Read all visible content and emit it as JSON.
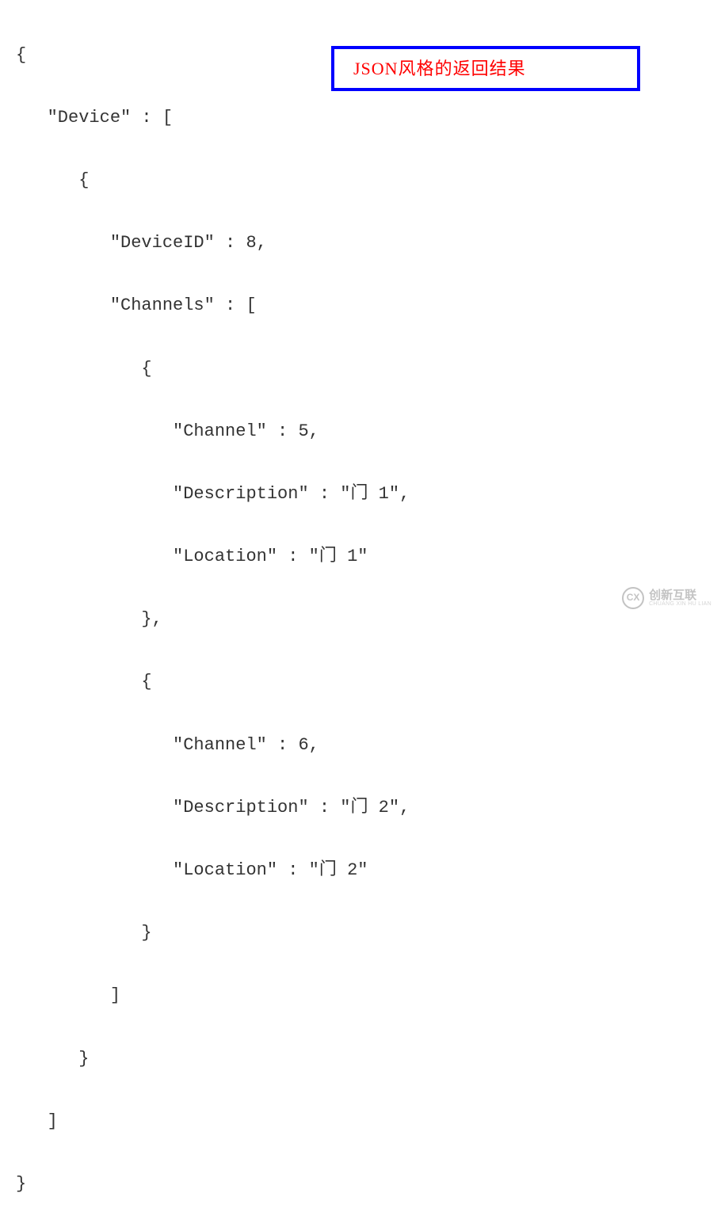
{
  "code": {
    "lines": [
      "{",
      "   \"Device\" : [",
      "      {",
      "         \"DeviceID\" : 8,",
      "         \"Channels\" : [",
      "            {",
      "               \"Channel\" : 5,",
      "               \"Description\" : \"门 1\",",
      "               \"Location\" : \"门 1\"",
      "            },",
      "            {",
      "               \"Channel\" : 6,",
      "               \"Description\" : \"门 2\",",
      "               \"Location\" : \"门 2\"",
      "            }",
      "         ]",
      "      }",
      "   ]",
      "}"
    ]
  },
  "annotation": {
    "text": "JSON风格的返回结果"
  },
  "watermark": {
    "icon": "CX",
    "main": "创新互联",
    "sub": "CHUANG XIN HU LIAN"
  }
}
